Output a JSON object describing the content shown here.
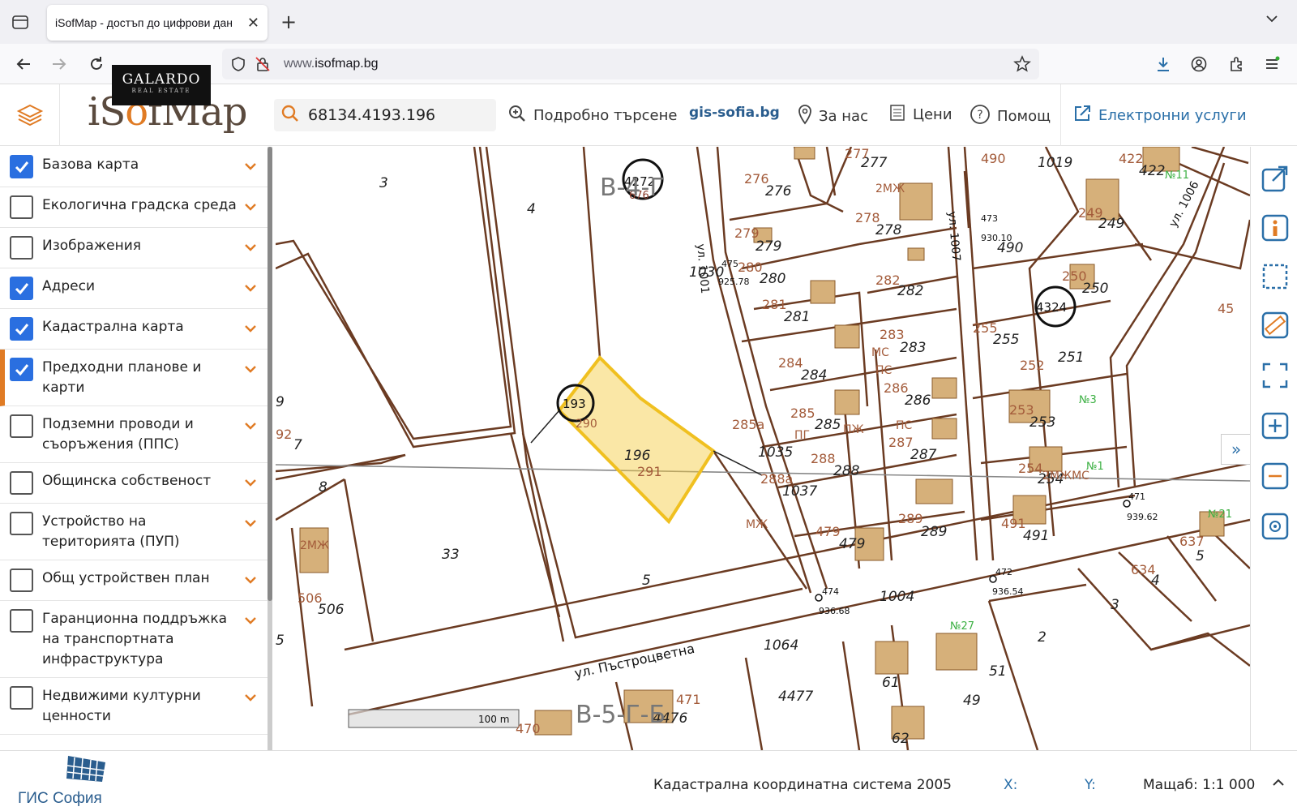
{
  "browser": {
    "tab_title": "iSofMap - достъп до цифрови дан",
    "url_prefix": "www.",
    "url_host": "isofmap.bg"
  },
  "watermark": {
    "brand": "GALARDO",
    "sub": "REAL ESTATE"
  },
  "header": {
    "logo_i": "i",
    "logo_s": "S",
    "logo_o": "o",
    "logo_f": "f",
    "logo_map": "Map",
    "search_value": "68134.4193.196",
    "advanced_search": "Подробно търсене",
    "gis_link": "gis-sofia.bg",
    "about": "За нас",
    "prices": "Цени",
    "help": "Помощ",
    "eservices": "Електронни услуги"
  },
  "sidebar": {
    "layers": [
      {
        "label": "Базова карта",
        "checked": true
      },
      {
        "label": "Екологична градска среда",
        "checked": false
      },
      {
        "label": "Изображения",
        "checked": false
      },
      {
        "label": "Адреси",
        "checked": true
      },
      {
        "label": "Кадастрална карта",
        "checked": true
      },
      {
        "label": "Предходни планове и карти",
        "checked": true
      },
      {
        "label": "Подземни проводи и съоръжения (ППС)",
        "checked": false
      },
      {
        "label": "Общинска собственост",
        "checked": false
      },
      {
        "label": "Устройство на територията (ПУП)",
        "checked": false
      },
      {
        "label": "Общ устройствен план",
        "checked": false
      },
      {
        "label": "Гаранционна поддръжка на транспортната инфраструктура",
        "checked": false
      },
      {
        "label": "Недвижими културни ценности",
        "checked": false
      }
    ]
  },
  "map": {
    "scale_label": "100 m",
    "labels": {
      "l3": "3",
      "l4": "4",
      "b4": "В-4-Г",
      "c4272": "4272",
      "c676": "676",
      "l276a": "276",
      "l276b": "276",
      "l277a": "277",
      "l277b": "277",
      "l278a": "278",
      "l278b": "278",
      "l279a": "279",
      "l279b": "279",
      "l280a": "280",
      "l280b": "280",
      "l281a": "281",
      "l281b": "281",
      "l282a": "282",
      "l282b": "282",
      "l283a": "283",
      "l283b": "283",
      "l284a": "284",
      "l284b": "284",
      "l285a": "285",
      "l285b": "285",
      "l285c": "285а",
      "l286a": "286",
      "l286b": "286",
      "l287a": "287",
      "l287b": "287",
      "l288a": "288",
      "l288b": "288",
      "l288c": "288а",
      "l289a": "289",
      "l289b": "289",
      "l479a": "479",
      "l479b": "479",
      "l473": "473",
      "l930": "930.10",
      "l490a": "490",
      "l490b": "490",
      "l475": "475",
      "l925": "925.78",
      "l1001": "ул. 1001",
      "l1007": "ул. 1007",
      "l1006": "ул. 1006",
      "l1019": "1019",
      "l1030": "1030",
      "l1035": "1035",
      "l1037": "1037",
      "l249a": "249",
      "l249b": "249",
      "l250a": "250",
      "l250b": "250",
      "c4324": "4324",
      "l255a": "255",
      "l255b": "255",
      "l251": "251",
      "l252": "252",
      "l253a": "253",
      "l253b": "253",
      "l254a": "254",
      "l254b": "254",
      "l491a": "491",
      "l491b": "491",
      "l422a": "422",
      "l422b": "422",
      "l45": "45",
      "n11": "№11",
      "n3": "№3",
      "n1": "№1",
      "n27": "№27",
      "n21": "№21",
      "l471a": "471",
      "l939": "939.62",
      "l472": "472",
      "l936b": "936.54",
      "l474": "474",
      "l936a": "936.68",
      "l637": "637",
      "l5r": "5",
      "l634": "634",
      "l4r": "4",
      "l3r": "3",
      "l2r": "2",
      "c193": "193",
      "l290": "290",
      "l196": "196",
      "l291": "291",
      "l9": "9",
      "l92": "92",
      "l7": "7",
      "l8": "8",
      "l33": "33",
      "l5": "5",
      "l506a": "506",
      "l506b": "506",
      "l5l": "5",
      "l1004": "1004",
      "l1064": "1064",
      "street": "ул. Пъстроцветна",
      "l4477": "4477",
      "l4476": "4476",
      "l471b": "471",
      "l470": "470",
      "l61": "61",
      "l51": "51",
      "l49": "49",
      "l62": "62",
      "b5": "В-5-Г-Б",
      "mzh": "МЖ",
      "zmzh": "2МЖ",
      "pg": "ПГ",
      "ps": "ПС",
      "ms": "МС",
      "pzh": "ПЖ",
      "ms2": "2МЖМС"
    }
  },
  "footer": {
    "gis_logo": "ГИС София",
    "coord_system": "Кадастрална координатна система 2005",
    "x_label": "X:",
    "y_label": "Y:",
    "scale": "Мащаб: 1:1 000"
  },
  "colors": {
    "accent": "#e07b24",
    "checkbox": "#2a6fe0",
    "parcel_line": "#6b3b22",
    "highlight": "#f3c93a",
    "building": "#d6b07a"
  },
  "icons": [
    "tab-list-icon",
    "close-icon",
    "plus-icon",
    "chevron-down-icon",
    "back-arrow-icon",
    "forward-arrow-icon",
    "reload-icon",
    "shield-icon",
    "lock-strike-icon",
    "star-icon",
    "download-icon",
    "account-icon",
    "extensions-icon",
    "menu-icon",
    "layers-icon",
    "search-icon",
    "zoom-search-icon",
    "pin-icon",
    "price-list-icon",
    "help-icon",
    "external-link-icon",
    "info-icon",
    "select-icon",
    "measure-icon",
    "fullscreen-icon",
    "zoom-in-icon",
    "zoom-out-icon",
    "locate-icon"
  ]
}
